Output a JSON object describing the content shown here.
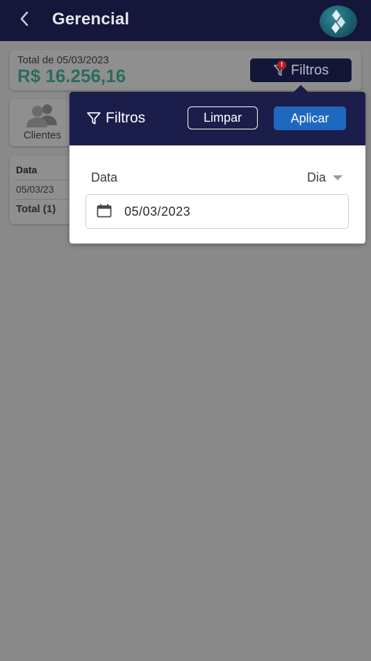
{
  "appbar": {
    "title": "Gerencial",
    "back_icon": "chevron-left-icon",
    "logo_icon": "brand-logo-icon"
  },
  "summary": {
    "label": "Total de 05/03/2023",
    "value": "R$ 16.256,16",
    "value_color": "#2c6b5d"
  },
  "filter_chip": {
    "label": "Filtros",
    "badge": "!",
    "icon": "filter-icon"
  },
  "clients": {
    "label": "Clientes",
    "icon": "users-icon"
  },
  "table": {
    "header": "Data",
    "rows": [
      "05/03/23"
    ],
    "total_label": "Total (1)"
  },
  "popover": {
    "title": "Filtros",
    "title_icon": "filter-icon",
    "clear_label": "Limpar",
    "apply_label": "Aplicar",
    "field_label": "Data",
    "period_value": "Dia",
    "date_value": "05/03/2023",
    "date_icon": "calendar-icon"
  },
  "colors": {
    "appbar_bg": "#14163a",
    "popover_header_bg": "#1b1e4a",
    "apply_bg": "#1f68c0",
    "overlay": "#8a8a8a"
  }
}
